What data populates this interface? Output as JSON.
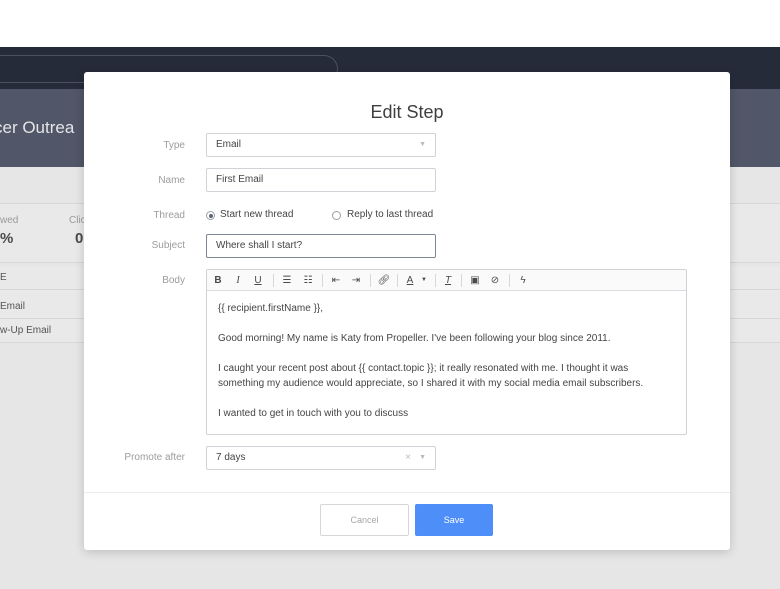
{
  "background": {
    "campaign_title": "cer Outrea",
    "stats": [
      {
        "label": "wed",
        "value": "%"
      },
      {
        "label": "Clic",
        "value": "0"
      }
    ],
    "table_rows": [
      "E",
      "Email",
      "w-Up Email"
    ]
  },
  "modal": {
    "title": "Edit Step",
    "type": {
      "label": "Type",
      "value": "Email"
    },
    "name": {
      "label": "Name",
      "value": "First Email"
    },
    "thread": {
      "label": "Thread",
      "options": [
        "Start new thread",
        "Reply to last thread"
      ],
      "selected": "Start new thread"
    },
    "subject": {
      "label": "Subject",
      "value": "Where shall I start?"
    },
    "body": {
      "label": "Body",
      "toolbar": {
        "bold": "B",
        "italic": "I",
        "underline": "U",
        "bullet_list": "bullet-list-icon",
        "numbered_list": "numbered-list-icon",
        "indent_decrease": "indent-decrease-icon",
        "indent_increase": "indent-increase-icon",
        "link": "link-icon",
        "text_color": "A",
        "clear_format": "T",
        "image": "image-icon",
        "attachment": "paperclip-icon",
        "snippet": "lightning-icon"
      },
      "lines": [
        "{{ recipient.firstName }},",
        "Good morning! My name is Katy from Propeller. I've been following your blog since 2011.",
        "I caught your recent post about {{ contact.topic }}; it really resonated with me. I thought it was",
        "something my audience would appreciate, so I shared it with my social media email subscribers.",
        "I wanted to get in touch with you to discuss"
      ]
    },
    "promote_after": {
      "label": "Promote after",
      "value": "7 days"
    },
    "cancel_label": "Cancel",
    "save_label": "Save",
    "colors": {
      "primary": "#4d8ef9",
      "header": "#262b3a",
      "overlay": "#e6e6e6"
    }
  }
}
